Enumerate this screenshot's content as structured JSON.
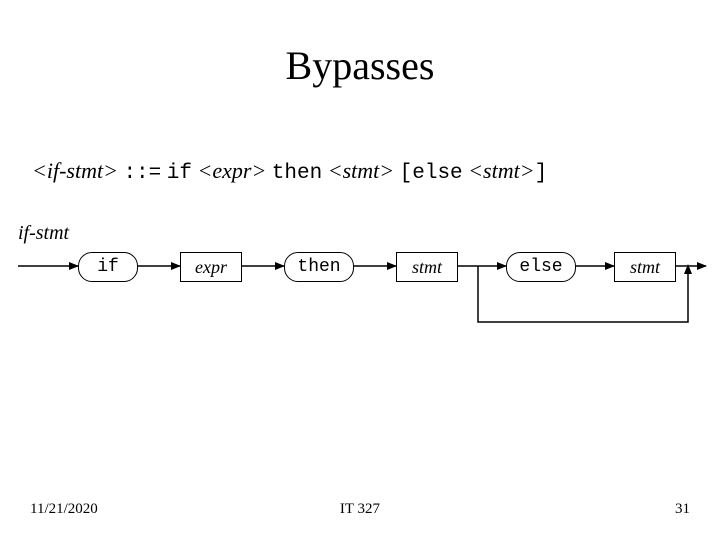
{
  "title": "Bypasses",
  "grammar": {
    "lhs": "if-stmt",
    "op": "::=",
    "rhs_parts": [
      "if",
      "expr",
      "then",
      "stmt",
      "else",
      "stmt"
    ]
  },
  "diagram": {
    "label": "if-stmt",
    "nodes": {
      "if": "if",
      "expr": "expr",
      "then": "then",
      "stmt1": "stmt",
      "else": "else",
      "stmt2": "stmt"
    }
  },
  "footer": {
    "date": "11/21/2020",
    "center": "IT 327",
    "page": "31"
  }
}
